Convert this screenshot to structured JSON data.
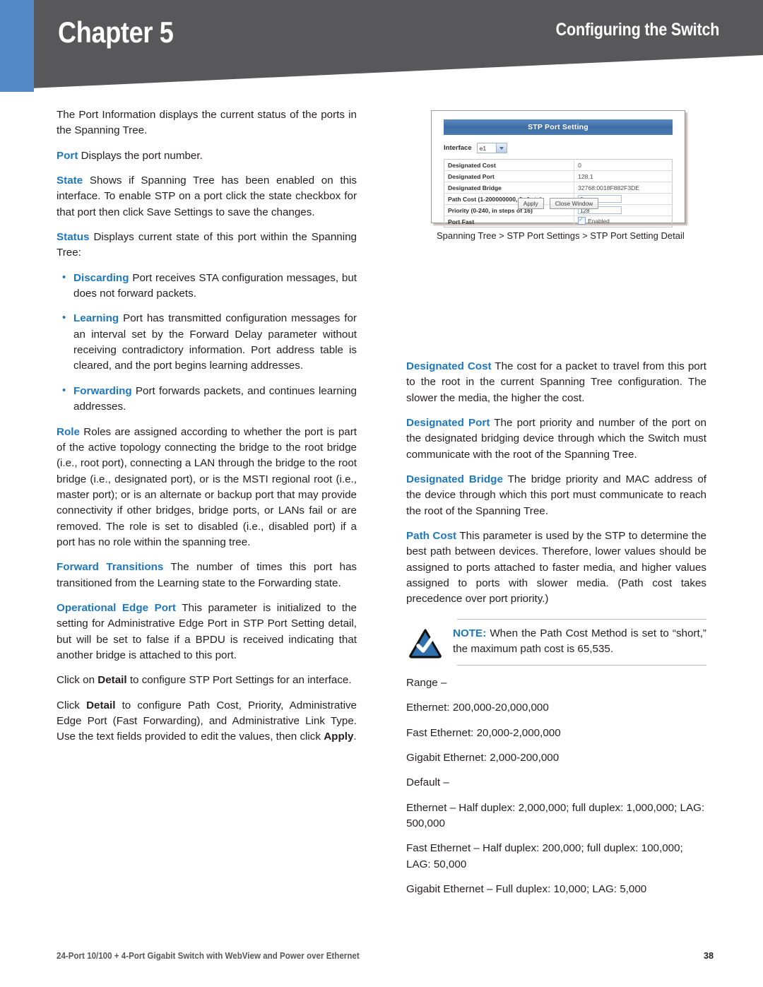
{
  "header": {
    "chapter_label": "Chapter 5",
    "section_title": "Configuring the Switch",
    "accent_blue": "#5588c7",
    "band_gray": "#58585a"
  },
  "left_column": {
    "intro": "The Port Information displays the current status of the ports in the Spanning Tree.",
    "entries": [
      {
        "term": "Port",
        "text": "Displays the port number."
      },
      {
        "term": "State",
        "text": "Shows if Spanning Tree has been enabled on this interface. To enable STP on a port click the state checkbox for that port then click Save Settings to save the changes."
      },
      {
        "term": "Status",
        "text": "Displays current state of this port within the Spanning Tree:"
      }
    ],
    "bullets": [
      {
        "term": "Discarding",
        "text": "Port receives STA configuration messages, but does not forward packets."
      },
      {
        "term": "Learning",
        "text": "Port has transmitted configuration messages for an interval set by the Forward Delay parameter without receiving contradictory information. Port address table is cleared, and the port begins learning addresses."
      },
      {
        "term": "Forwarding",
        "text": "Port forwards packets, and continues learning addresses."
      }
    ],
    "entries2": [
      {
        "term": "Role",
        "text": "Roles are assigned according to whether the port is part of the active topology connecting the bridge to the root bridge (i.e., root port), connecting a LAN through the bridge to the root bridge (i.e., designated port), or is the MSTI regional root (i.e., master port); or is an alternate or backup port that may provide connectivity if other bridges, bridge ports, or LANs fail or are removed. The role is set to disabled (i.e., disabled port) if a port has no role within the spanning tree."
      },
      {
        "term": "Forward Transitions",
        "text": "The number of times this port has transitioned from the Learning state to the Forwarding state."
      },
      {
        "term": "Operational Edge Port",
        "text": "This parameter is initialized to the setting for Administrative Edge Port in STP Port Setting detail, but will be set to false if a BPDU is received indicating that another bridge is attached to this port."
      }
    ],
    "closing": [
      {
        "pre": "Click on ",
        "bold": "Detail",
        "post": " to configure STP Port Settings for an interface."
      },
      {
        "pre": "Click ",
        "bold": "Detail",
        "post": " to configure Path Cost, Priority, Administrative Edge Port (Fast Forwarding), and Administrative Link Type. Use the text fields provided to edit the values, then click ",
        "bold2": "Apply",
        "post2": "."
      }
    ]
  },
  "screenshot": {
    "window_title": "STP Port Setting",
    "interface_label": "Interface",
    "interface_value": "e1",
    "rows": [
      {
        "label": "Designated Cost",
        "value": "0",
        "kind": "text"
      },
      {
        "label": "Designated Port",
        "value": "128.1",
        "kind": "text"
      },
      {
        "label": "Designated Bridge",
        "value": "32768:0018F882F3DE",
        "kind": "text"
      },
      {
        "label": "Path Cost (1-200000000, 0: Auto)",
        "value": "0",
        "kind": "input"
      },
      {
        "label": "Priority (0-240, in steps of 16)",
        "value": "128",
        "kind": "input"
      },
      {
        "label": "Port Fast",
        "value": "Enabled",
        "kind": "checkbox"
      }
    ],
    "apply_button": "Apply",
    "close_button": "Close Window",
    "caption": "Spanning Tree > STP Port Settings > STP Port Setting Detail"
  },
  "right_column": {
    "entries": [
      {
        "term": "Designated Cost",
        "text": "The cost for a packet to travel from this port to the root in the current Spanning Tree configuration. The slower the media, the higher the cost."
      },
      {
        "term": "Designated Port",
        "text": "The port priority and number of the port on the designated bridging device through which the Switch must communicate with the root of the Spanning Tree."
      },
      {
        "term": "Designated Bridge",
        "text": "The bridge priority and MAC address of the device through which this port must communicate to reach the root of the Spanning Tree."
      },
      {
        "term": "Path Cost",
        "text": "This parameter is used by the STP to determine the best path between devices. Therefore, lower values should be assigned to ports attached to faster media, and higher values assigned to ports with slower media. (Path cost takes precedence over port priority.)"
      }
    ],
    "note": {
      "label": "NOTE:",
      "text": "When the Path Cost Method is set to “short,” the maximum path cost is 65,535.",
      "icon": "checkmark-triangle-icon"
    },
    "range_heading": "Range –",
    "range_items": [
      "Ethernet: 200,000-20,000,000",
      "Fast Ethernet: 20,000-2,000,000",
      "Gigabit Ethernet: 2,000-200,000"
    ],
    "default_heading": "Default –",
    "default_items": [
      "Ethernet – Half duplex: 2,000,000; full duplex: 1,000,000; LAG: 500,000",
      "Fast Ethernet – Half duplex: 200,000; full duplex: 100,000; LAG: 50,000",
      "Gigabit Ethernet – Full duplex: 10,000; LAG: 5,000"
    ]
  },
  "footer": {
    "product": "24-Port 10/100 + 4-Port Gigabit Switch with WebView and Power over Ethernet",
    "page_number": "38"
  }
}
